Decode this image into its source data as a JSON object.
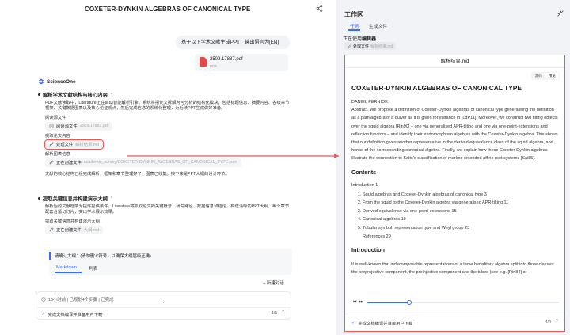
{
  "left": {
    "doc_title": "COXETER-DYNKIN ALGEBRAS OF CANONICAL TYPE",
    "user_message": "基于以下学术文献生成PPT，输出语言为[EN]",
    "attachment": {
      "name": "2509.17887.pdf",
      "type": "PDF"
    },
    "brand": "ScienceOne",
    "section1": {
      "title": "解析学术文献结构与核心内容",
      "desc": "PDF文献读取中，Literature正在启动智能解析引擎。系统将把论文拆解为可分析的结构化模块，包括标题信息、摘要内容、各级章节框架、关键数据图表以及核心论证观点，然后完成信息的系统化整理，为后续PPT生成做好准备。",
      "read_label": "阅读源文件",
      "read_chip": {
        "label": "阅读源文件",
        "file": "2509.17887.pdf"
      },
      "extract_label": "提取论文内容",
      "process_chip": {
        "label": "处理文件",
        "file": "解析结果.md"
      },
      "chart_label": "解析图表信息",
      "create_chip": {
        "label": "正在创建文件",
        "file": "academic_survey/COXETER-DYNKIN_ALGEBRAS_OF_CANONICAL_TYPE.json"
      },
      "done_text": "文献的核心结构已经完成解析，框架和章节整理好了，图表已收集。接下来是PPT大纲的设计环节。"
    },
    "section2": {
      "title": "提取关键信息并构建演示大纲",
      "desc": "解析后的文献框架为提炼提供条件，Literature将抓取论文的关键概念、研究路径、数据信息和结论，构建清晰的PPT大纲，每个章节配套合适幻灯片，突出学术展示效果。",
      "extract_label": "提取关键信息并构建演示大纲",
      "create_chip": {
        "label": "正在创建文件",
        "file": "大纲.md"
      }
    },
    "confirm": {
      "text": "请确认大纲：(请勿删'#'符号，以确保大纲层级正确)",
      "tab_markdown": "Markdown",
      "tab_list": "列表"
    },
    "new_chat": "+ 新建对话",
    "status": {
      "summary": "16小时前 | 已规划4个步骤 | 已完成",
      "task": "完成文档编译并准备用户下载",
      "count": "4/4"
    }
  },
  "right": {
    "title": "工作区",
    "tab_task": "任务",
    "tab_generate": "生成文件",
    "using_prefix": "正在使用",
    "using_tool": "编辑器",
    "chip": {
      "label": "处理文件",
      "file": "解析结果.md"
    },
    "viewer": {
      "filename": "解析结果.md",
      "toggle_source": "源码",
      "toggle_preview": "预览",
      "doc_title": "COXETER-DYNKIN ALGEBRAS OF CANONICAL TYPE",
      "author": "DANIEL PERNIOK",
      "abstract": "Abstract. We propose a definition of Coxeter-Dynkin algebras of canonical type generalising the definition as a path algebra of a quiver as it is given for instance in [LdP11]. Moreover, we construct two tilting objects over the squid algebra [Rin90] – one via generalised APR-tilting and one via one-point-extensions and reflection functors – and identify their endomorphism algebras with the Coxeter-Dynkin algebra. This shows that our definition gives another representative in the derived equivalence class of the squid algebra, and hence of the corresponding canonical algebra. Finally, we explain how these Coxeter-Dynkin algebras illustrate the connection to Saito's classification of marked extended affine root systems [Sai85].",
      "contents_title": "Contents",
      "toc_intro": "Introduction 1",
      "toc": [
        "Squid algebras and Coxeter-Dynkin algebras of canonical type 3",
        "From the squid to the Coxeter-Dynkin algebra via generalised APR-tilting 11",
        "Derived equivalence via one-point-extensions 15",
        "Canonical algebras 19",
        "Tubular symbol, representation type and Weyl group 23"
      ],
      "toc_refs": "References 29",
      "intro_title": "Introduction",
      "intro_text": "It is well-known that indecomposable representations of a tame hereditary algebra split into three classes: the preprojective component, the preinjective component and the tubes (see e.g. [Rin84] or",
      "progress": 0.22,
      "footer_task": "完成文档编译并准备用户下载",
      "footer_count": "4/4"
    }
  }
}
